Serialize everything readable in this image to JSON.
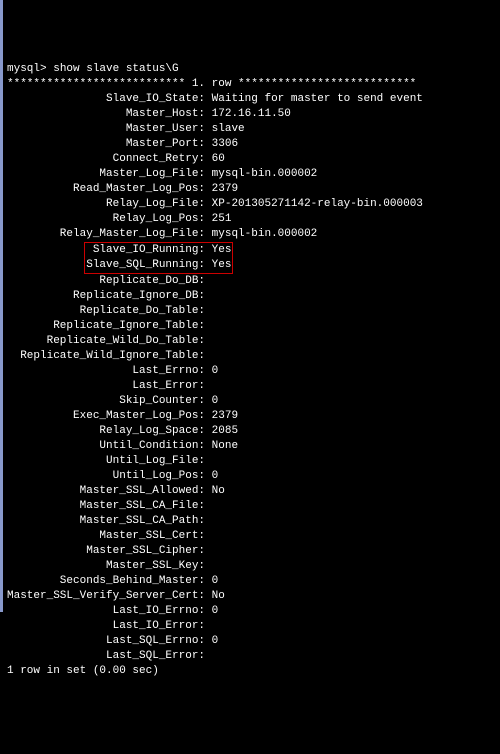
{
  "prompt": "mysql>",
  "command": "show slave status\\G",
  "separator": "*************************** 1. row ***************************",
  "fields": [
    {
      "name": "Slave_IO_State",
      "value": "Waiting for master to send event"
    },
    {
      "name": "Master_Host",
      "value": "172.16.11.50"
    },
    {
      "name": "Master_User",
      "value": "slave"
    },
    {
      "name": "Master_Port",
      "value": "3306"
    },
    {
      "name": "Connect_Retry",
      "value": "60"
    },
    {
      "name": "Master_Log_File",
      "value": "mysql-bin.000002"
    },
    {
      "name": "Read_Master_Log_Pos",
      "value": "2379"
    },
    {
      "name": "Relay_Log_File",
      "value": "XP-201305271142-relay-bin.000003"
    },
    {
      "name": "Relay_Log_Pos",
      "value": "251"
    },
    {
      "name": "Relay_Master_Log_File",
      "value": "mysql-bin.000002"
    },
    {
      "name": "Slave_IO_Running",
      "value": "Yes",
      "highlight": true
    },
    {
      "name": "Slave_SQL_Running",
      "value": "Yes",
      "highlight": true
    },
    {
      "name": "Replicate_Do_DB",
      "value": ""
    },
    {
      "name": "Replicate_Ignore_DB",
      "value": ""
    },
    {
      "name": "Replicate_Do_Table",
      "value": ""
    },
    {
      "name": "Replicate_Ignore_Table",
      "value": ""
    },
    {
      "name": "Replicate_Wild_Do_Table",
      "value": ""
    },
    {
      "name": "Replicate_Wild_Ignore_Table",
      "value": ""
    },
    {
      "name": "Last_Errno",
      "value": "0"
    },
    {
      "name": "Last_Error",
      "value": ""
    },
    {
      "name": "Skip_Counter",
      "value": "0"
    },
    {
      "name": "Exec_Master_Log_Pos",
      "value": "2379"
    },
    {
      "name": "Relay_Log_Space",
      "value": "2085"
    },
    {
      "name": "Until_Condition",
      "value": "None"
    },
    {
      "name": "Until_Log_File",
      "value": ""
    },
    {
      "name": "Until_Log_Pos",
      "value": "0"
    },
    {
      "name": "Master_SSL_Allowed",
      "value": "No"
    },
    {
      "name": "Master_SSL_CA_File",
      "value": ""
    },
    {
      "name": "Master_SSL_CA_Path",
      "value": ""
    },
    {
      "name": "Master_SSL_Cert",
      "value": ""
    },
    {
      "name": "Master_SSL_Cipher",
      "value": ""
    },
    {
      "name": "Master_SSL_Key",
      "value": ""
    },
    {
      "name": "Seconds_Behind_Master",
      "value": "0"
    },
    {
      "name": "Master_SSL_Verify_Server_Cert",
      "value": "No"
    },
    {
      "name": "Last_IO_Errno",
      "value": "0"
    },
    {
      "name": "Last_IO_Error",
      "value": ""
    },
    {
      "name": "Last_SQL_Errno",
      "value": "0"
    },
    {
      "name": "Last_SQL_Error",
      "value": ""
    }
  ],
  "footer": "1 row in set (0.00 sec)",
  "label_width": 29
}
